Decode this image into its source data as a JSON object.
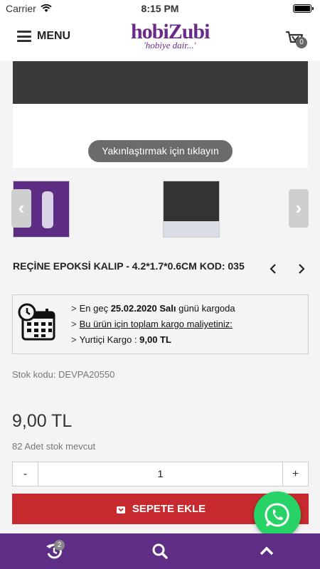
{
  "status_bar": {
    "carrier": "Carrier",
    "time": "8:15 PM"
  },
  "header": {
    "menu_label": "MENU",
    "logo": {
      "brand": "hobiZubi",
      "tagline": "'hobiye dair...'"
    },
    "cart_count": "0"
  },
  "image": {
    "zoom_hint": "Yakınlaştırmak için tıklayın"
  },
  "product": {
    "title": "REÇİNE EPOKSİ KALIP - 4.2*1.7*0.6CM KOD: 035",
    "stock_code": "Stok kodu: DEVPA20550",
    "price": "9,00 TL",
    "stock_count": "82 Adet stok mevcut",
    "quantity": "1"
  },
  "shipping": {
    "line1_prefix": "En geç ",
    "line1_date": "25.02.2020 Salı",
    "line1_suffix": " günü kargoda",
    "line2": "Bu ürün için toplam kargo maliyetiniz:",
    "line3_prefix": "Yurtiçi Kargo : ",
    "line3_value": "9,00 TL"
  },
  "quantity_controls": {
    "minus": "-",
    "plus": "+"
  },
  "add_to_cart_label": "SEPETE EKLE",
  "bottom_bar": {
    "history_badge": "2"
  },
  "colors": {
    "brand_purple": "#5e2e86",
    "add_to_cart_red": "#c62a2e",
    "whatsapp_green": "#27d366"
  }
}
